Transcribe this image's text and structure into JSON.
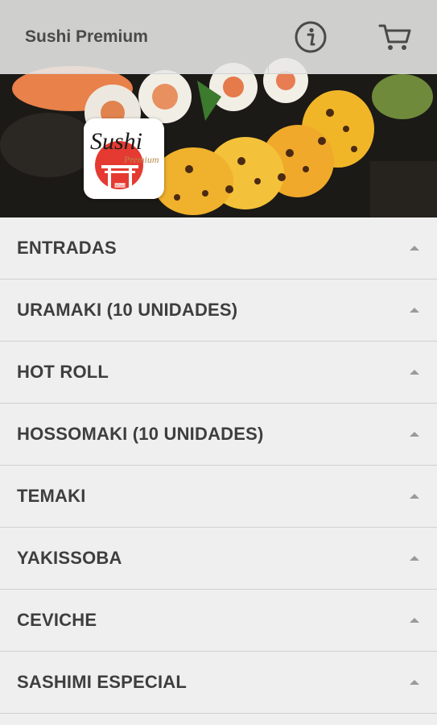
{
  "header": {
    "title": "Sushi Premium",
    "info_icon": "info-icon",
    "cart_icon": "cart-icon"
  },
  "logo": {
    "brand_text": "Sushi",
    "sub_text": "Premium",
    "tag_text": "Delivery"
  },
  "categories": [
    {
      "label": "ENTRADAS"
    },
    {
      "label": "URAMAKI (10 UNIDADES)"
    },
    {
      "label": "HOT ROLL"
    },
    {
      "label": "HOSSOMAKI (10 UNIDADES)"
    },
    {
      "label": "TEMAKI"
    },
    {
      "label": "YAKISSOBA"
    },
    {
      "label": "CEVICHE"
    },
    {
      "label": "SASHIMI ESPECIAL"
    }
  ],
  "colors": {
    "background": "#efefef",
    "text": "#3e3e3e",
    "caret": "#9a9a9a",
    "divider": "#d0d0d0"
  }
}
